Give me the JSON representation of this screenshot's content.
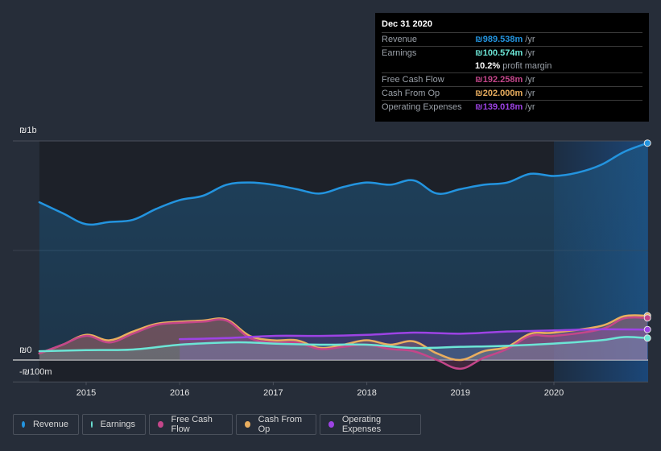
{
  "tooltip": {
    "date": "Dec 31 2020",
    "rows": [
      {
        "label": "Revenue",
        "value": "₪989.538m",
        "unit": "/yr",
        "color": "#2394df"
      },
      {
        "label": "Earnings",
        "value": "₪100.574m",
        "unit": "/yr",
        "color": "#6ce5d6"
      },
      {
        "label": "Free Cash Flow",
        "value": "₪192.258m",
        "unit": "/yr",
        "color": "#c4468a"
      },
      {
        "label": "Cash From Op",
        "value": "₪202.000m",
        "unit": "/yr",
        "color": "#e9ae5f"
      },
      {
        "label": "Operating Expenses",
        "value": "₪139.018m",
        "unit": "/yr",
        "color": "#9d43e4"
      }
    ],
    "profit_margin_value": "10.2%",
    "profit_margin_label": "profit margin"
  },
  "legend": [
    {
      "label": "Revenue",
      "color": "#2394df"
    },
    {
      "label": "Earnings",
      "color": "#6ce5d6"
    },
    {
      "label": "Free Cash Flow",
      "color": "#c4468a"
    },
    {
      "label": "Cash From Op",
      "color": "#e9ae5f"
    },
    {
      "label": "Operating Expenses",
      "color": "#9d43e4"
    }
  ],
  "chart_data": {
    "type": "area",
    "title": "",
    "xlabel": "",
    "ylabel": "",
    "currency": "₪",
    "ylim": [
      -100,
      1000
    ],
    "y_ticks": [
      {
        "value": 1000,
        "label": "₪1b"
      },
      {
        "value": 0,
        "label": "₪0"
      },
      {
        "value": -100,
        "label": "-₪100m"
      }
    ],
    "x_ticks": [
      2015,
      2016,
      2017,
      2018,
      2019,
      2020
    ],
    "xlim": [
      2014.5,
      2021.0
    ],
    "forecast_shade_from": 2020.0,
    "grid": true,
    "legend_position": "bottom",
    "series": [
      {
        "name": "Revenue",
        "color": "#2394df",
        "x": [
          2014.5,
          2014.75,
          2015.0,
          2015.25,
          2015.5,
          2015.75,
          2016.0,
          2016.25,
          2016.5,
          2016.75,
          2017.0,
          2017.25,
          2017.5,
          2017.75,
          2018.0,
          2018.25,
          2018.5,
          2018.75,
          2019.0,
          2019.25,
          2019.5,
          2019.75,
          2020.0,
          2020.25,
          2020.5,
          2020.75,
          2021.0
        ],
        "values": [
          720,
          670,
          620,
          630,
          640,
          690,
          730,
          750,
          800,
          810,
          800,
          780,
          760,
          790,
          810,
          800,
          820,
          760,
          780,
          800,
          810,
          850,
          840,
          855,
          890,
          950,
          990
        ]
      },
      {
        "name": "Earnings",
        "color": "#6ce5d6",
        "x": [
          2014.5,
          2015.0,
          2015.5,
          2016.0,
          2016.5,
          2016.75,
          2017.0,
          2017.5,
          2018.0,
          2018.5,
          2019.0,
          2019.5,
          2020.0,
          2020.5,
          2020.75,
          2021.0
        ],
        "values": [
          40,
          45,
          48,
          70,
          80,
          80,
          75,
          70,
          70,
          55,
          60,
          65,
          75,
          90,
          105,
          100
        ]
      },
      {
        "name": "Free Cash Flow",
        "color": "#c4468a",
        "x": [
          2014.5,
          2014.75,
          2015.0,
          2015.25,
          2015.5,
          2015.75,
          2016.0,
          2016.25,
          2016.5,
          2016.75,
          2017.0,
          2017.25,
          2017.5,
          2017.75,
          2018.0,
          2018.25,
          2018.5,
          2018.75,
          2019.0,
          2019.25,
          2019.5,
          2019.75,
          2020.0,
          2020.5,
          2020.75,
          2021.0
        ],
        "values": [
          30,
          70,
          110,
          80,
          120,
          160,
          170,
          175,
          180,
          100,
          80,
          80,
          50,
          60,
          70,
          50,
          40,
          0,
          -40,
          10,
          50,
          110,
          110,
          140,
          190,
          192
        ]
      },
      {
        "name": "Cash From Op",
        "color": "#e9ae5f",
        "x": [
          2014.5,
          2014.75,
          2015.0,
          2015.25,
          2015.5,
          2015.75,
          2016.0,
          2016.25,
          2016.5,
          2016.75,
          2017.0,
          2017.25,
          2017.5,
          2017.75,
          2018.0,
          2018.25,
          2018.5,
          2018.75,
          2019.0,
          2019.25,
          2019.5,
          2019.75,
          2020.0,
          2020.5,
          2020.75,
          2021.0
        ],
        "values": [
          30,
          70,
          115,
          90,
          130,
          165,
          175,
          180,
          185,
          110,
          90,
          90,
          55,
          70,
          90,
          70,
          85,
          30,
          0,
          40,
          60,
          120,
          125,
          155,
          200,
          202
        ]
      },
      {
        "name": "Operating Expenses",
        "color": "#9d43e4",
        "x": [
          2016.0,
          2016.5,
          2017.0,
          2017.5,
          2018.0,
          2018.5,
          2019.0,
          2019.5,
          2020.0,
          2020.5,
          2021.0
        ],
        "values": [
          95,
          100,
          110,
          110,
          115,
          125,
          120,
          130,
          135,
          140,
          139
        ]
      }
    ]
  }
}
